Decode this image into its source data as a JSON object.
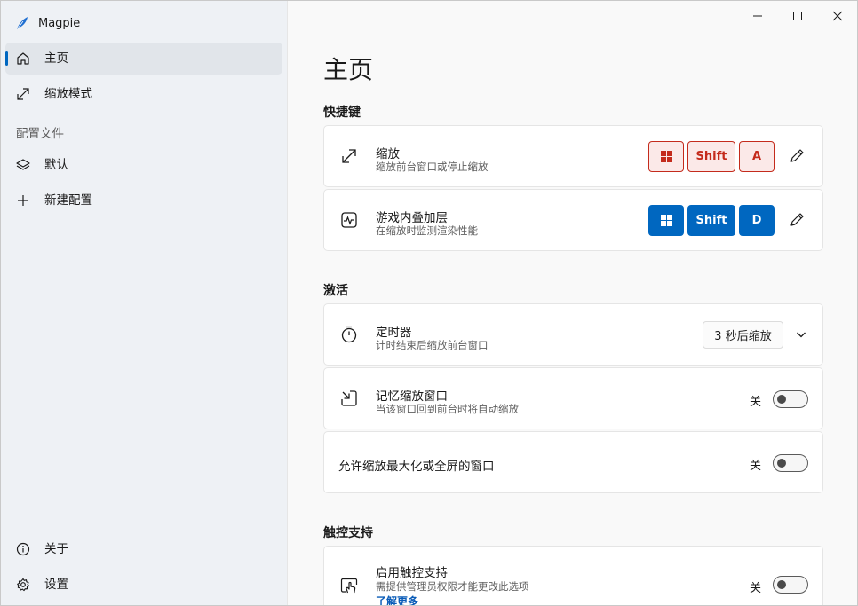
{
  "app": {
    "title": "Magpie"
  },
  "sidebar": {
    "items": [
      {
        "label": "主页",
        "icon": "home-icon"
      },
      {
        "label": "缩放模式",
        "icon": "scale-mode-icon"
      }
    ],
    "profiles_label": "配置文件",
    "profiles": [
      {
        "label": "默认",
        "icon": "layers-icon"
      },
      {
        "label": "新建配置",
        "icon": "plus-icon"
      }
    ],
    "footer": [
      {
        "label": "关于",
        "icon": "info-icon"
      },
      {
        "label": "设置",
        "icon": "gear-icon"
      }
    ]
  },
  "main": {
    "title": "主页",
    "hotkeys": {
      "section": "快捷键",
      "scale": {
        "title": "缩放",
        "desc": "缩放前台窗口或停止缩放",
        "keys": [
          "⊞",
          "Shift",
          "A"
        ]
      },
      "overlay": {
        "title": "游戏内叠加层",
        "desc": "在缩放时监测渲染性能",
        "keys": [
          "⊞",
          "Shift",
          "D"
        ]
      }
    },
    "activation": {
      "section": "激活",
      "timer": {
        "title": "定时器",
        "desc": "计时结束后缩放前台窗口",
        "value": "3 秒后缩放"
      },
      "remember": {
        "title": "记忆缩放窗口",
        "desc": "当该窗口回到前台时将自动缩放",
        "state": "关"
      },
      "allow_max": {
        "title": "允许缩放最大化或全屏的窗口",
        "state": "关"
      }
    },
    "touch": {
      "section": "触控支持",
      "enable": {
        "title": "启用触控支持",
        "desc": "需提供管理员权限才能更改此选项",
        "link": "了解更多",
        "state": "关"
      }
    }
  },
  "colors": {
    "accent": "#0067c0",
    "conflict": "#c42b1c"
  }
}
